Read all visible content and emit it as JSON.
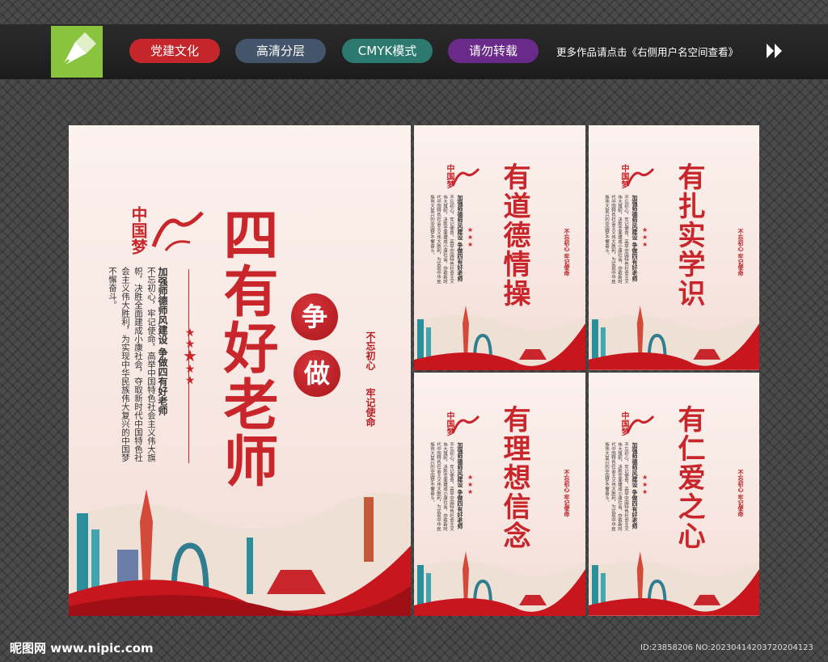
{
  "header": {
    "tags": [
      {
        "label": "党建文化",
        "color": "#c4262c"
      },
      {
        "label": "高清分层",
        "color": "#44546a"
      },
      {
        "label": "CMYK模式",
        "color": "#2c7a6f"
      },
      {
        "label": "请勿转载",
        "color": "#6a2a8a"
      }
    ],
    "more_link": "更多作品请点击《右侧用户名空间查看》"
  },
  "main_poster": {
    "logo_text": "中国梦",
    "title": "四有好老师",
    "circle_1": "争",
    "circle_2": "做",
    "subtitle": "加强师德师风建设 争做四有好老师",
    "body": "不忘初心，牢记使命，高举中国特色社会主义伟大旗帜，决胜全面建成小康社会，夺取新时代中国特色社会主义伟大胜利，为实现中华民族伟大复兴的中国梦不懈奋斗。",
    "side_1": "不忘初心",
    "side_2": "牢记使命"
  },
  "small_posters": [
    {
      "title": "有道德情操"
    },
    {
      "title": "有扎实学识"
    },
    {
      "title": "有理想信念"
    },
    {
      "title": "有仁爱之心"
    }
  ],
  "small_common": {
    "logo_text": "中国梦",
    "subtitle": "加强师德师风建设 争做四有好老师",
    "body": "不忘初心，牢记使命，高举中国特色社会主义伟大旗帜，决胜全面建成小康社会，夺取新时代中国特色社会主义伟大胜利，为实现中华民族伟大复兴的中国梦不懈奋斗。",
    "side": "不忘初心 牢记使命"
  },
  "footer": {
    "site": "昵图网 www.nipic.com",
    "id": "ID:23858206 NO:20230414203720204123"
  }
}
